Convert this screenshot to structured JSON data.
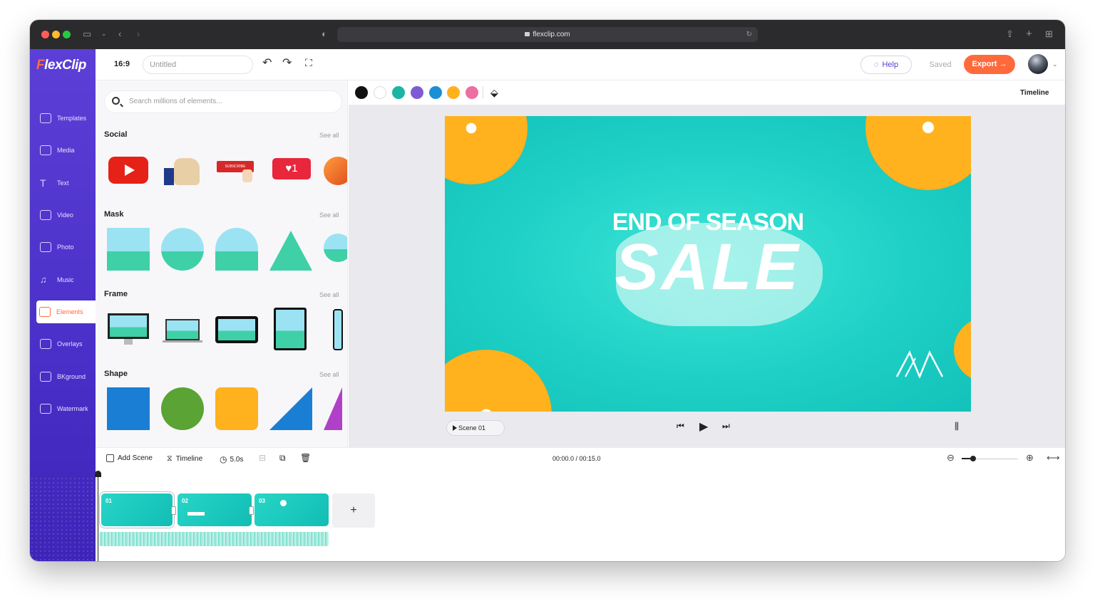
{
  "browser": {
    "url": "flexclip.com"
  },
  "app": {
    "logo": "FlexClip"
  },
  "sidebar": {
    "items": [
      {
        "label": "Templates",
        "icon": "templates-icon"
      },
      {
        "label": "Media",
        "icon": "media-icon"
      },
      {
        "label": "Text",
        "icon": "text-icon"
      },
      {
        "label": "Video",
        "icon": "video-icon"
      },
      {
        "label": "Photo",
        "icon": "photo-icon"
      },
      {
        "label": "Music",
        "icon": "music-icon"
      },
      {
        "label": "Elements",
        "icon": "elements-icon",
        "active": true
      },
      {
        "label": "Overlays",
        "icon": "overlays-icon"
      },
      {
        "label": "BKground",
        "icon": "background-icon"
      },
      {
        "label": "Watermark",
        "icon": "watermark-icon"
      }
    ]
  },
  "toolbar": {
    "ratio": "16:9",
    "project_title": "Untitled",
    "help_label": "Help",
    "saved_label": "Saved",
    "export_label": "Export"
  },
  "panel": {
    "search_placeholder": "Search millions of elements...",
    "sections": [
      {
        "title": "Social",
        "see_all": "See all"
      },
      {
        "title": "Mask",
        "see_all": "See all"
      },
      {
        "title": "Frame",
        "see_all": "See all"
      },
      {
        "title": "Shape",
        "see_all": "See all"
      }
    ],
    "social_thumbs": {
      "subscribe_text": "SUBSCRIBE",
      "like_count": "1"
    }
  },
  "colorbar": {
    "colors": [
      "#111111",
      "#ffffff",
      "#1ab5a4",
      "#7e5bd6",
      "#1a8fd6",
      "#ffb21e",
      "#ec6ea2"
    ],
    "timeline_label": "Timeline"
  },
  "canvas": {
    "headline": "END OF SEASON",
    "big_text": "SALE",
    "bg_color": "#1ed0c6"
  },
  "player": {
    "scene_label": "Scene 01"
  },
  "timeline": {
    "add_scene": "Add Scene",
    "timeline_label": "Timeline",
    "duration": "5.0s",
    "time": "00:00.0 / 00:15.0",
    "clips": [
      {
        "num": "01"
      },
      {
        "num": "02"
      },
      {
        "num": "03"
      }
    ],
    "add_label": "+"
  }
}
